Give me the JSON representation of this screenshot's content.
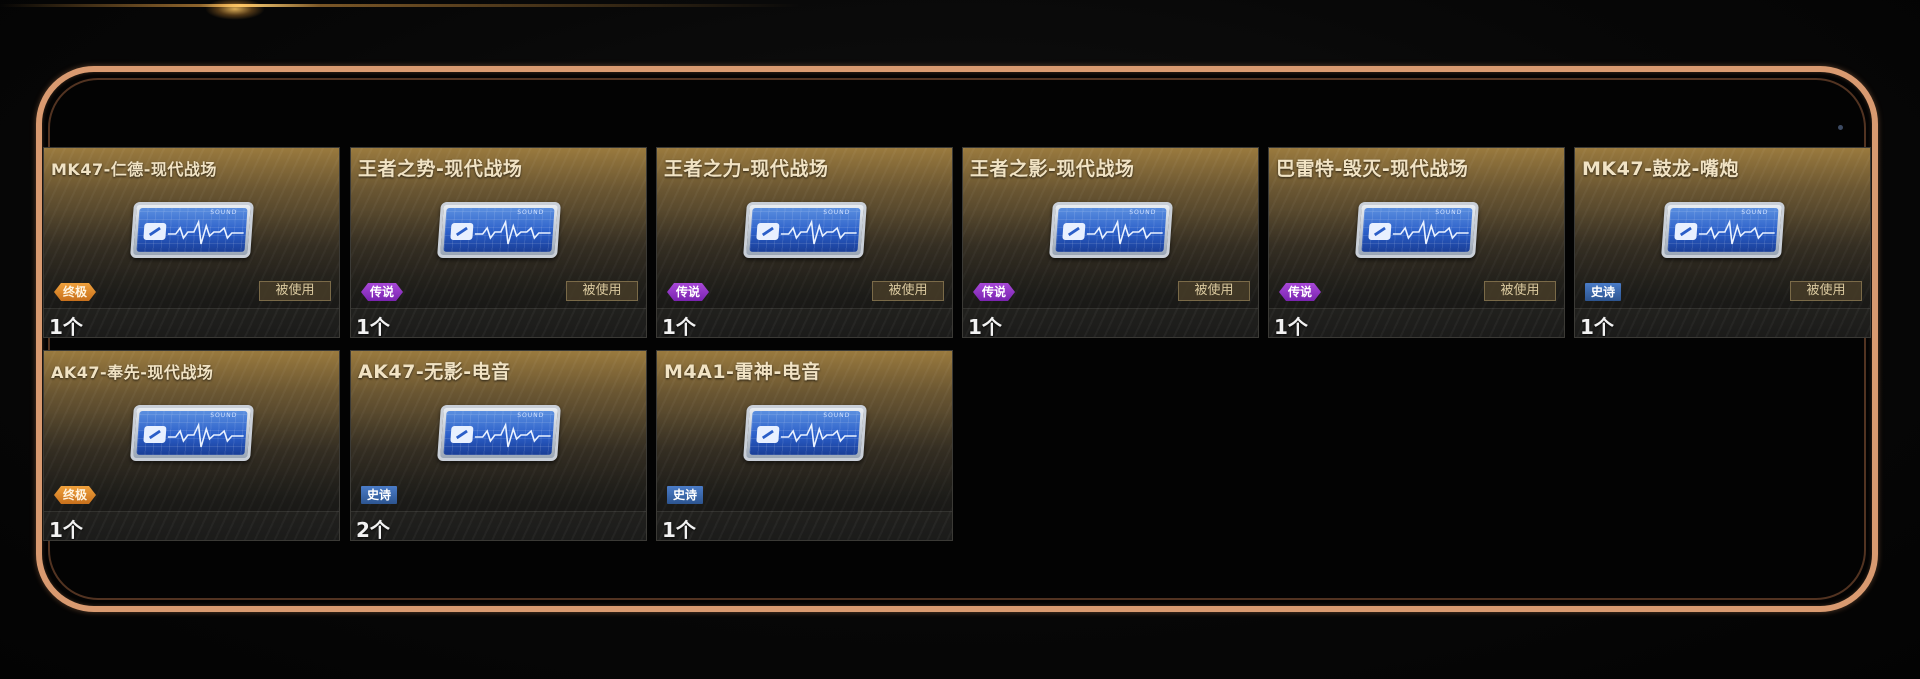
{
  "items": [
    {
      "title": "MK47-仁德-现代战场",
      "rarity": "终极",
      "rarity_type": "ultimate",
      "used_label": "被使用",
      "count": "1个"
    },
    {
      "title": "王者之势-现代战场",
      "rarity": "传说",
      "rarity_type": "legend",
      "used_label": "被使用",
      "count": "1个"
    },
    {
      "title": "王者之力-现代战场",
      "rarity": "传说",
      "rarity_type": "legend",
      "used_label": "被使用",
      "count": "1个"
    },
    {
      "title": "王者之影-现代战场",
      "rarity": "传说",
      "rarity_type": "legend",
      "used_label": "被使用",
      "count": "1个"
    },
    {
      "title": "巴雷特-毁灭-现代战场",
      "rarity": "传说",
      "rarity_type": "legend",
      "used_label": "被使用",
      "count": "1个"
    },
    {
      "title": "MK47-鼓龙-嘴炮",
      "rarity": "史诗",
      "rarity_type": "epic",
      "used_label": "被使用",
      "count": "1个"
    },
    {
      "title": "AK47-奉先-现代战场",
      "rarity": "终极",
      "rarity_type": "ultimate",
      "count": "1个"
    },
    {
      "title": "AK47-无影-电音",
      "rarity": "史诗",
      "rarity_type": "epic",
      "count": "2个"
    },
    {
      "title": "M4A1-雷神-电音",
      "rarity": "史诗",
      "rarity_type": "epic",
      "count": "1个"
    }
  ],
  "card_art": {
    "label": "SOUND",
    "icon": "sound-card-icon"
  },
  "colors": {
    "frame": "#d99a70",
    "legend": "#9a3ccc",
    "ultimate": "#e08c2c",
    "epic": "#3f6cb0"
  }
}
